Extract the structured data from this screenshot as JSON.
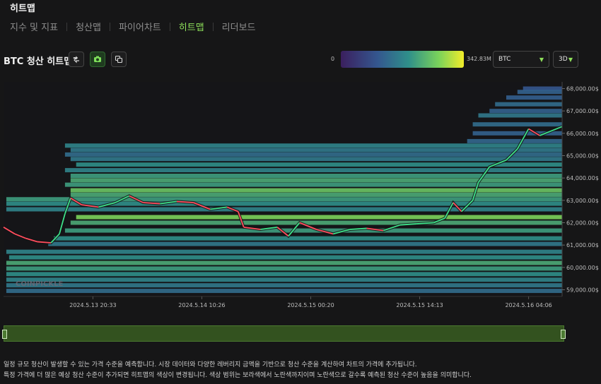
{
  "page": {
    "title": "히트맵"
  },
  "nav": {
    "tabs": [
      "지수 및 지표",
      "청산맵",
      "파이어차트",
      "히트맵",
      "리더보드"
    ],
    "active_index": 3
  },
  "header": {
    "chart_title": "BTC 청산 히트맵",
    "buttons": [
      {
        "name": "refresh-icon"
      },
      {
        "name": "camera-icon"
      },
      {
        "name": "copy-icon"
      }
    ],
    "scale": {
      "min_label": "0",
      "max_label": "342.83M",
      "colors": [
        "#3b1f5e",
        "#34578f",
        "#2f8f8a",
        "#7bd35a",
        "#f2ec2a"
      ]
    },
    "symbol_select": {
      "value": "BTC"
    },
    "range_select": {
      "value": "3D"
    }
  },
  "watermark": "COINPICKLE",
  "chart_data": {
    "type": "heatmap",
    "title": "BTC 청산 히트맵",
    "y_unit": "$",
    "ylim": [
      58700,
      68300
    ],
    "y_ticks": [
      "59,000.00$",
      "60,000.00$",
      "61,000.00$",
      "62,000.00$",
      "63,000.00$",
      "64,000.00$",
      "65,000.00$",
      "66,000.00$",
      "67,000.00$",
      "68,000.00$"
    ],
    "x_ticks": [
      "2024.5.13 20:33",
      "2024.5.14 10:26",
      "2024.5.15 00:20",
      "2024.5.15 14:13",
      "2024.5.16 04:06"
    ],
    "price_series": [
      {
        "t": 0,
        "p": 61800
      },
      {
        "t": 0.02,
        "p": 61500
      },
      {
        "t": 0.04,
        "p": 61300
      },
      {
        "t": 0.06,
        "p": 61150
      },
      {
        "t": 0.085,
        "p": 61100
      },
      {
        "t": 0.1,
        "p": 61500
      },
      {
        "t": 0.11,
        "p": 62400
      },
      {
        "t": 0.12,
        "p": 63100
      },
      {
        "t": 0.14,
        "p": 62800
      },
      {
        "t": 0.17,
        "p": 62700
      },
      {
        "t": 0.2,
        "p": 62900
      },
      {
        "t": 0.225,
        "p": 63200
      },
      {
        "t": 0.25,
        "p": 62900
      },
      {
        "t": 0.28,
        "p": 62850
      },
      {
        "t": 0.31,
        "p": 62950
      },
      {
        "t": 0.34,
        "p": 62900
      },
      {
        "t": 0.37,
        "p": 62600
      },
      {
        "t": 0.4,
        "p": 62700
      },
      {
        "t": 0.42,
        "p": 62500
      },
      {
        "t": 0.43,
        "p": 61800
      },
      {
        "t": 0.46,
        "p": 61700
      },
      {
        "t": 0.49,
        "p": 61800
      },
      {
        "t": 0.51,
        "p": 61400
      },
      {
        "t": 0.53,
        "p": 62000
      },
      {
        "t": 0.56,
        "p": 61700
      },
      {
        "t": 0.59,
        "p": 61500
      },
      {
        "t": 0.62,
        "p": 61700
      },
      {
        "t": 0.65,
        "p": 61750
      },
      {
        "t": 0.68,
        "p": 61650
      },
      {
        "t": 0.71,
        "p": 61900
      },
      {
        "t": 0.74,
        "p": 61950
      },
      {
        "t": 0.77,
        "p": 62000
      },
      {
        "t": 0.79,
        "p": 62200
      },
      {
        "t": 0.805,
        "p": 62900
      },
      {
        "t": 0.82,
        "p": 62500
      },
      {
        "t": 0.84,
        "p": 63000
      },
      {
        "t": 0.85,
        "p": 63800
      },
      {
        "t": 0.87,
        "p": 64500
      },
      {
        "t": 0.9,
        "p": 64800
      },
      {
        "t": 0.92,
        "p": 65300
      },
      {
        "t": 0.94,
        "p": 66200
      },
      {
        "t": 0.96,
        "p": 65900
      },
      {
        "t": 0.98,
        "p": 66100
      },
      {
        "t": 1.0,
        "p": 66300
      }
    ],
    "levels": [
      {
        "price": 68000,
        "start": 0.93,
        "intensity": 0.25
      },
      {
        "price": 67850,
        "start": 0.92,
        "intensity": 0.3
      },
      {
        "price": 67600,
        "start": 0.9,
        "intensity": 0.28
      },
      {
        "price": 67300,
        "start": 0.88,
        "intensity": 0.35
      },
      {
        "price": 67000,
        "start": 0.87,
        "intensity": 0.3
      },
      {
        "price": 66800,
        "start": 0.85,
        "intensity": 0.4
      },
      {
        "price": 66400,
        "start": 0.84,
        "intensity": 0.35
      },
      {
        "price": 66000,
        "start": 0.84,
        "intensity": 0.3
      },
      {
        "price": 65650,
        "start": 0.83,
        "intensity": 0.32
      },
      {
        "price": 65450,
        "start": 0.11,
        "intensity": 0.45
      },
      {
        "price": 65250,
        "start": 0.12,
        "intensity": 0.4
      },
      {
        "price": 65050,
        "start": 0.11,
        "intensity": 0.35
      },
      {
        "price": 64850,
        "start": 0.12,
        "intensity": 0.4
      },
      {
        "price": 64600,
        "start": 0.13,
        "intensity": 0.5
      },
      {
        "price": 64350,
        "start": 0.11,
        "intensity": 0.45
      },
      {
        "price": 64100,
        "start": 0.12,
        "intensity": 0.55
      },
      {
        "price": 63900,
        "start": 0.12,
        "intensity": 0.6
      },
      {
        "price": 63700,
        "start": 0.11,
        "intensity": 0.55
      },
      {
        "price": 63450,
        "start": 0.12,
        "intensity": 0.7
      },
      {
        "price": 63250,
        "start": 0.12,
        "intensity": 0.6
      },
      {
        "price": 63050,
        "start": 0.005,
        "intensity": 0.55
      },
      {
        "price": 62850,
        "start": 0.005,
        "intensity": 0.5
      },
      {
        "price": 62600,
        "start": 0.005,
        "intensity": 0.45
      },
      {
        "price": 62250,
        "start": 0.13,
        "intensity": 0.75
      },
      {
        "price": 62000,
        "start": 0.12,
        "intensity": 0.6
      },
      {
        "price": 61650,
        "start": 0.11,
        "intensity": 0.55
      },
      {
        "price": 61300,
        "start": 0.09,
        "intensity": 0.5
      },
      {
        "price": 61050,
        "start": 0.08,
        "intensity": 0.4
      },
      {
        "price": 60700,
        "start": 0.005,
        "intensity": 0.45
      },
      {
        "price": 60450,
        "start": 0.01,
        "intensity": 0.5
      },
      {
        "price": 60200,
        "start": 0.005,
        "intensity": 0.6
      },
      {
        "price": 59950,
        "start": 0.005,
        "intensity": 0.55
      },
      {
        "price": 59700,
        "start": 0.005,
        "intensity": 0.5
      },
      {
        "price": 59450,
        "start": 0.005,
        "intensity": 0.45
      },
      {
        "price": 59200,
        "start": 0.005,
        "intensity": 0.4
      },
      {
        "price": 58950,
        "start": 0.005,
        "intensity": 0.35
      }
    ]
  },
  "footer": {
    "line1": "일정 규모 청산이 발생할 수 있는 가격 수준을 예측합니다. 시장 데이터와 다양한 레버리지 금액을 기반으로 청산 수준을 계산하여 차트의 가격에 추가됩니다.",
    "line2": "특정 가격에 더 많은 예상 청산 수준이 추가되면 히트맵의 색상이 변경됩니다. 색상 범위는 보라색에서 노란색까지이며 노란색으로 갈수록 예측된 청산 수준이 높음을 의미합니다."
  }
}
